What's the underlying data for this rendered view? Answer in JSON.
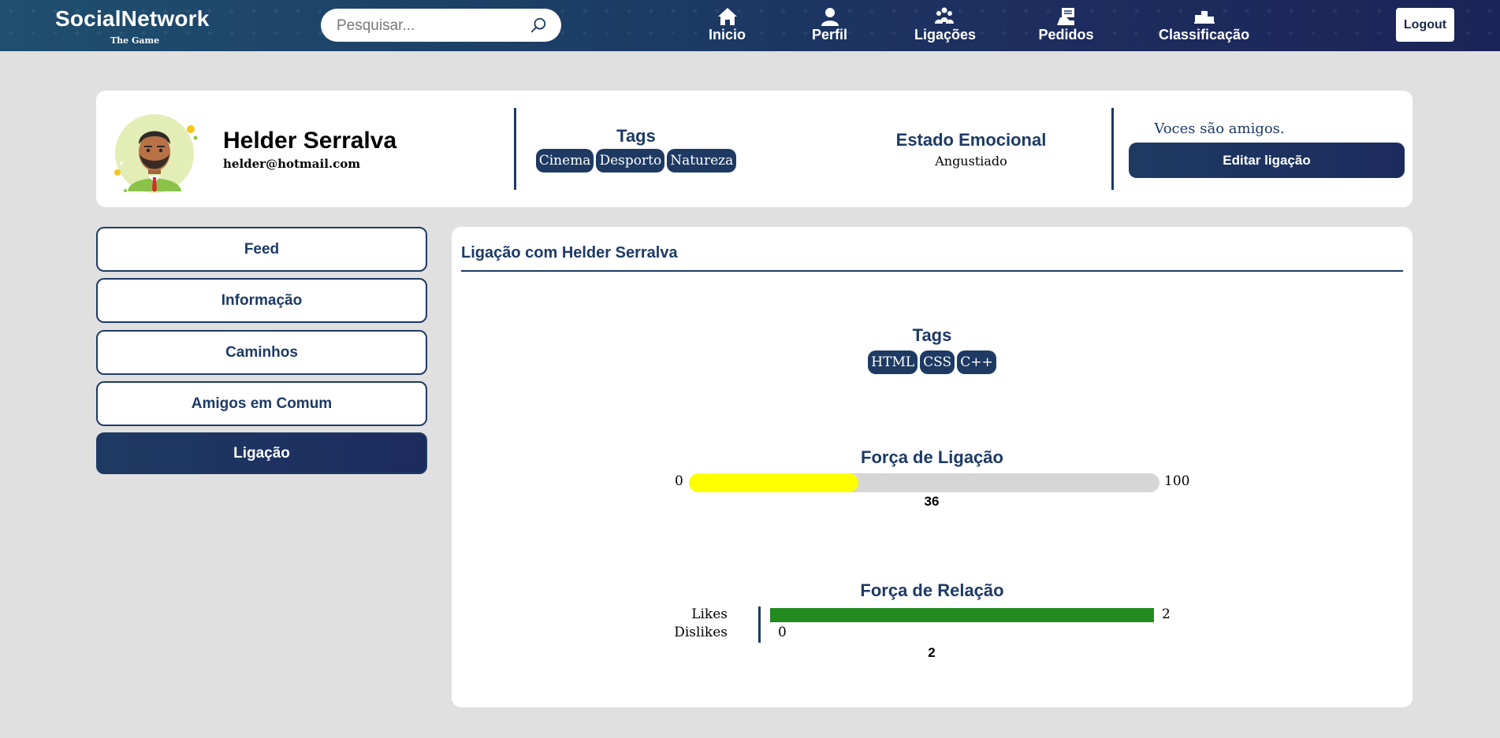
{
  "header": {
    "brand_title": "SocialNetwork",
    "brand_subtitle": "The Game",
    "search_placeholder": "Pesquisar...",
    "nav": [
      {
        "label": "Inicio",
        "icon": "home-icon"
      },
      {
        "label": "Perfil",
        "icon": "user-icon"
      },
      {
        "label": "Ligações",
        "icon": "group-icon"
      },
      {
        "label": "Pedidos",
        "icon": "requests-icon"
      },
      {
        "label": "Classificação",
        "icon": "podium-icon"
      }
    ],
    "logout_label": "Logout"
  },
  "profile": {
    "name": "Helder Serralva",
    "email": "helder@hotmail.com",
    "tags_title": "Tags",
    "tags": [
      "Cinema",
      "Desporto",
      "Natureza"
    ],
    "emotion_title": "Estado Emocional",
    "emotion_value": "Angustiado",
    "friends_text": "Voces são amigos.",
    "edit_label": "Editar ligação"
  },
  "sidebar": {
    "items": [
      {
        "label": "Feed",
        "active": false
      },
      {
        "label": "Informação",
        "active": false
      },
      {
        "label": "Caminhos",
        "active": false
      },
      {
        "label": "Amigos em Comum",
        "active": false
      },
      {
        "label": "Ligação",
        "active": true
      }
    ]
  },
  "panel": {
    "title": "Ligação com Helder Serralva",
    "tags_title": "Tags",
    "tags": [
      "HTML",
      "CSS",
      "C++"
    ],
    "strength": {
      "title": "Força de Ligação",
      "min": "0",
      "max": "100",
      "value": 36,
      "value_label": "36",
      "color": "#ffff00"
    },
    "relation": {
      "title": "Força de Relação",
      "likes_label": "Likes",
      "dislikes_label": "Dislikes",
      "likes": 2,
      "likes_label_value": "2",
      "dislikes": 0,
      "dislikes_label_value": "0",
      "total_label": "2",
      "likes_color": "#228b22"
    }
  },
  "colors": {
    "primary": "#1d3a66",
    "background": "#e0e0e0"
  }
}
